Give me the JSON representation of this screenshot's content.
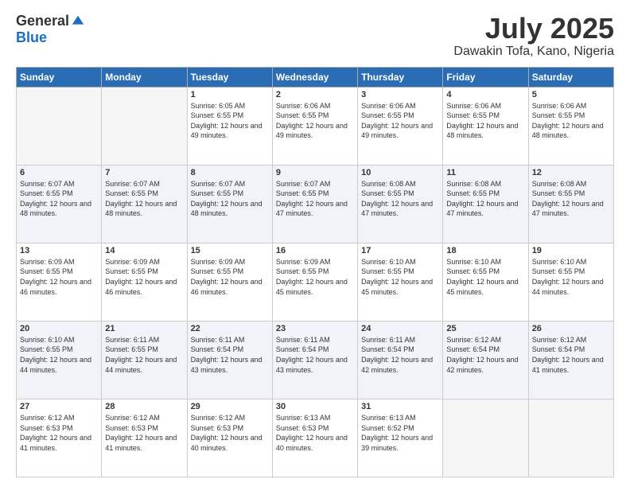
{
  "header": {
    "logo_general": "General",
    "logo_blue": "Blue",
    "month_title": "July 2025",
    "location": "Dawakin Tofa, Kano, Nigeria"
  },
  "weekdays": [
    "Sunday",
    "Monday",
    "Tuesday",
    "Wednesday",
    "Thursday",
    "Friday",
    "Saturday"
  ],
  "weeks": [
    [
      {
        "day": "",
        "info": ""
      },
      {
        "day": "",
        "info": ""
      },
      {
        "day": "1",
        "info": "Sunrise: 6:05 AM\nSunset: 6:55 PM\nDaylight: 12 hours and 49 minutes."
      },
      {
        "day": "2",
        "info": "Sunrise: 6:06 AM\nSunset: 6:55 PM\nDaylight: 12 hours and 49 minutes."
      },
      {
        "day": "3",
        "info": "Sunrise: 6:06 AM\nSunset: 6:55 PM\nDaylight: 12 hours and 49 minutes."
      },
      {
        "day": "4",
        "info": "Sunrise: 6:06 AM\nSunset: 6:55 PM\nDaylight: 12 hours and 48 minutes."
      },
      {
        "day": "5",
        "info": "Sunrise: 6:06 AM\nSunset: 6:55 PM\nDaylight: 12 hours and 48 minutes."
      }
    ],
    [
      {
        "day": "6",
        "info": "Sunrise: 6:07 AM\nSunset: 6:55 PM\nDaylight: 12 hours and 48 minutes."
      },
      {
        "day": "7",
        "info": "Sunrise: 6:07 AM\nSunset: 6:55 PM\nDaylight: 12 hours and 48 minutes."
      },
      {
        "day": "8",
        "info": "Sunrise: 6:07 AM\nSunset: 6:55 PM\nDaylight: 12 hours and 48 minutes."
      },
      {
        "day": "9",
        "info": "Sunrise: 6:07 AM\nSunset: 6:55 PM\nDaylight: 12 hours and 47 minutes."
      },
      {
        "day": "10",
        "info": "Sunrise: 6:08 AM\nSunset: 6:55 PM\nDaylight: 12 hours and 47 minutes."
      },
      {
        "day": "11",
        "info": "Sunrise: 6:08 AM\nSunset: 6:55 PM\nDaylight: 12 hours and 47 minutes."
      },
      {
        "day": "12",
        "info": "Sunrise: 6:08 AM\nSunset: 6:55 PM\nDaylight: 12 hours and 47 minutes."
      }
    ],
    [
      {
        "day": "13",
        "info": "Sunrise: 6:09 AM\nSunset: 6:55 PM\nDaylight: 12 hours and 46 minutes."
      },
      {
        "day": "14",
        "info": "Sunrise: 6:09 AM\nSunset: 6:55 PM\nDaylight: 12 hours and 46 minutes."
      },
      {
        "day": "15",
        "info": "Sunrise: 6:09 AM\nSunset: 6:55 PM\nDaylight: 12 hours and 46 minutes."
      },
      {
        "day": "16",
        "info": "Sunrise: 6:09 AM\nSunset: 6:55 PM\nDaylight: 12 hours and 45 minutes."
      },
      {
        "day": "17",
        "info": "Sunrise: 6:10 AM\nSunset: 6:55 PM\nDaylight: 12 hours and 45 minutes."
      },
      {
        "day": "18",
        "info": "Sunrise: 6:10 AM\nSunset: 6:55 PM\nDaylight: 12 hours and 45 minutes."
      },
      {
        "day": "19",
        "info": "Sunrise: 6:10 AM\nSunset: 6:55 PM\nDaylight: 12 hours and 44 minutes."
      }
    ],
    [
      {
        "day": "20",
        "info": "Sunrise: 6:10 AM\nSunset: 6:55 PM\nDaylight: 12 hours and 44 minutes."
      },
      {
        "day": "21",
        "info": "Sunrise: 6:11 AM\nSunset: 6:55 PM\nDaylight: 12 hours and 44 minutes."
      },
      {
        "day": "22",
        "info": "Sunrise: 6:11 AM\nSunset: 6:54 PM\nDaylight: 12 hours and 43 minutes."
      },
      {
        "day": "23",
        "info": "Sunrise: 6:11 AM\nSunset: 6:54 PM\nDaylight: 12 hours and 43 minutes."
      },
      {
        "day": "24",
        "info": "Sunrise: 6:11 AM\nSunset: 6:54 PM\nDaylight: 12 hours and 42 minutes."
      },
      {
        "day": "25",
        "info": "Sunrise: 6:12 AM\nSunset: 6:54 PM\nDaylight: 12 hours and 42 minutes."
      },
      {
        "day": "26",
        "info": "Sunrise: 6:12 AM\nSunset: 6:54 PM\nDaylight: 12 hours and 41 minutes."
      }
    ],
    [
      {
        "day": "27",
        "info": "Sunrise: 6:12 AM\nSunset: 6:53 PM\nDaylight: 12 hours and 41 minutes."
      },
      {
        "day": "28",
        "info": "Sunrise: 6:12 AM\nSunset: 6:53 PM\nDaylight: 12 hours and 41 minutes."
      },
      {
        "day": "29",
        "info": "Sunrise: 6:12 AM\nSunset: 6:53 PM\nDaylight: 12 hours and 40 minutes."
      },
      {
        "day": "30",
        "info": "Sunrise: 6:13 AM\nSunset: 6:53 PM\nDaylight: 12 hours and 40 minutes."
      },
      {
        "day": "31",
        "info": "Sunrise: 6:13 AM\nSunset: 6:52 PM\nDaylight: 12 hours and 39 minutes."
      },
      {
        "day": "",
        "info": ""
      },
      {
        "day": "",
        "info": ""
      }
    ]
  ]
}
